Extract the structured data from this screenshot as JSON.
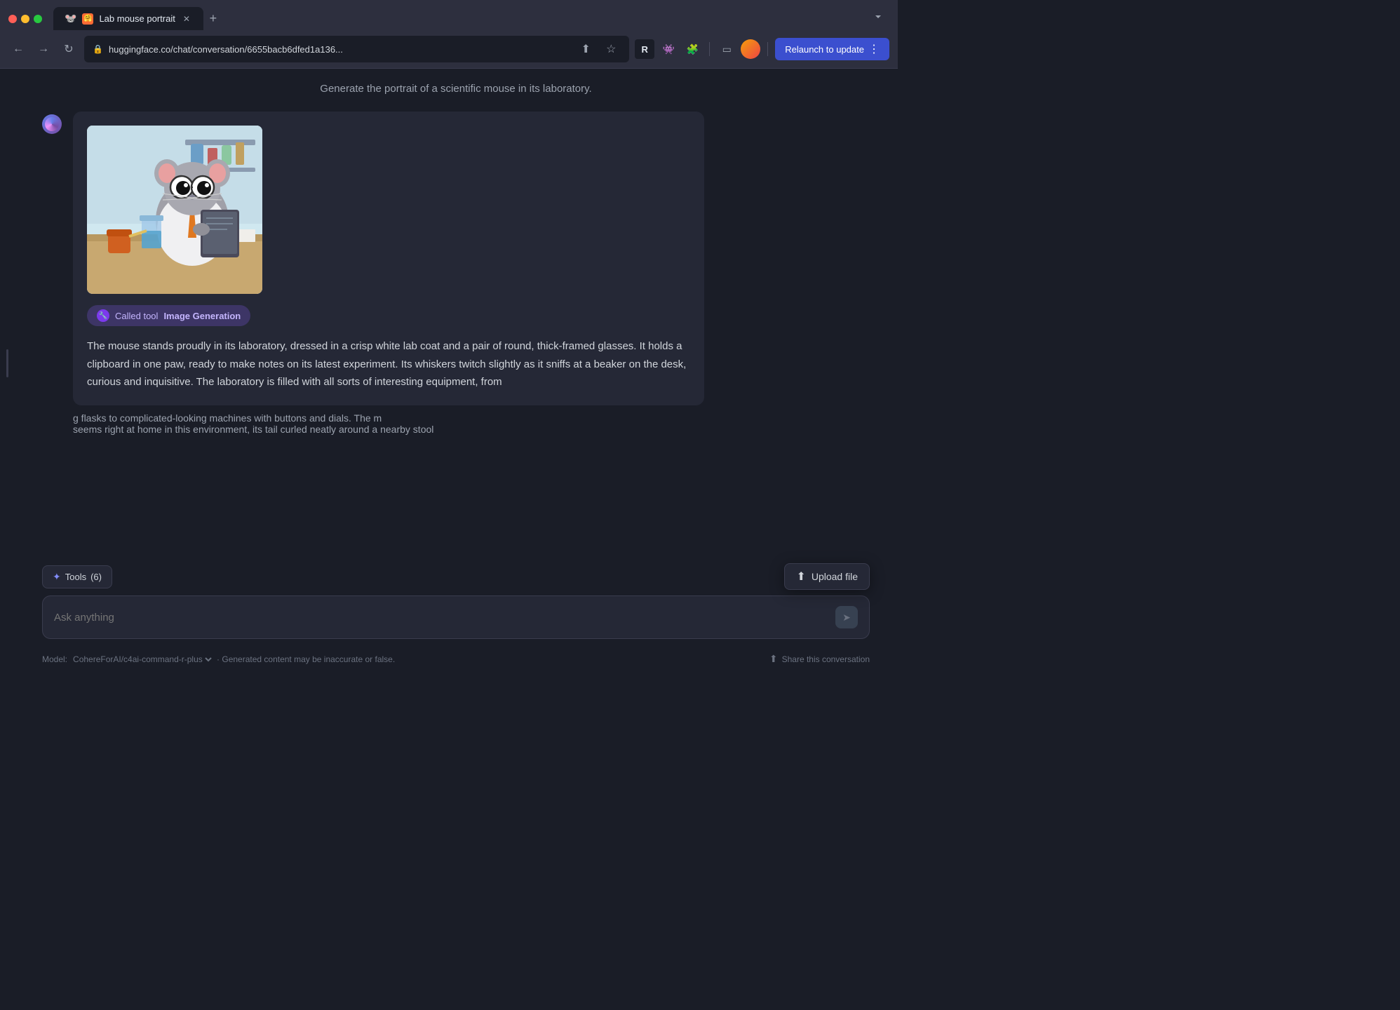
{
  "browser": {
    "url": "huggingface.co/chat/conversation/6655bacb6dfed1a136...",
    "tab_title": "Lab mouse portrait",
    "tab_emoji": "🐭",
    "relaunch_label": "Relaunch to update"
  },
  "chat": {
    "user_message": "Generate the portrait of a scientific mouse in its laboratory.",
    "tool_badge_label": "Called tool ",
    "tool_badge_name": "Image Generation",
    "message_text": "The mouse stands proudly in its laboratory, dressed in a crisp white lab coat and a pair of round, thick-framed glasses. It holds a clipboard in one paw, ready to make notes on its latest experiment. Its whiskers twitch slightly as it sniffs at a beaker on the desk, curious and inquisitive. The laboratory is filled with all sorts of interesting equipment, from",
    "message_text2": "g flasks to complicated-looking machines with buttons and dials. The m",
    "message_text3": "seems right at home in this environment, its tail curled neatly around a nearby stool"
  },
  "toolbar": {
    "tools_label": "Tools",
    "tools_count": "(6)",
    "upload_label": "Upload file",
    "input_placeholder": "Ask anything"
  },
  "footer": {
    "model_prefix": "Model: ",
    "model_name": "CohereForAI/c4ai-command-r-plus",
    "disclaimer": " · Generated content may be inaccurate or false.",
    "share_label": "Share this conversation"
  }
}
